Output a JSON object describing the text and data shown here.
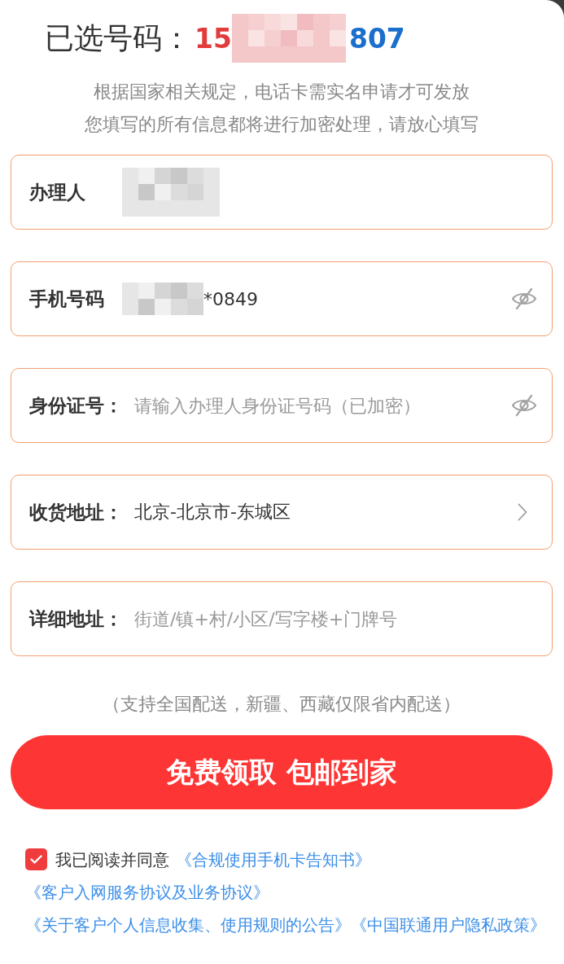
{
  "header": {
    "label": "已选号码：",
    "number_start": "15",
    "number_redacted": true,
    "number_end": "807"
  },
  "notice": [
    "根据国家相关规定，电话卡需实名申请才可发放",
    "您填写的所有信息都将进行加密处理，请放心填写"
  ],
  "fields": [
    {
      "kind": "text",
      "label": "办理人",
      "redacted": true
    },
    {
      "kind": "secret",
      "label": "手机号码",
      "redacted": true,
      "value": "*0849"
    },
    {
      "kind": "secret",
      "label": "身份证号：",
      "redacted": false,
      "placeholder": "请输入办理人身份证号码（已加密）"
    },
    {
      "kind": "select",
      "label": "收货地址：",
      "redacted": false,
      "value": "北京-北京市-东城区"
    },
    {
      "kind": "text",
      "label": "详细地址：",
      "redacted": false,
      "placeholder": "街道/镇+村/小区/写字楼+门牌号"
    }
  ],
  "delivery_note": "（支持全国配送，新疆、西藏仅限省内配送）",
  "submit_button": "免费领取 包邮到家",
  "agreement": {
    "checked": true,
    "text": "我已阅读并同意",
    "links": [
      "《合规使用手机卡告知书》",
      "《客户入网服务协议及业务协议》",
      "《关于客户个人信息收集、使用规则的公告》",
      "《中国联通用户隐私政策》"
    ]
  }
}
